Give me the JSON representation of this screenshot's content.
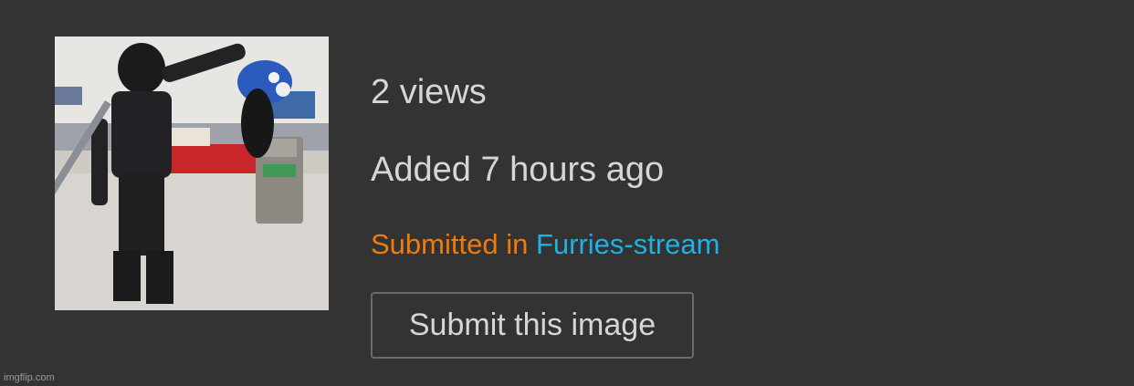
{
  "image": {
    "alt": "GIF thumbnail"
  },
  "stats": {
    "views": "2 views",
    "added": "Added 7 hours ago"
  },
  "submission": {
    "prefix": "Submitted in",
    "stream": "Furries-stream"
  },
  "actions": {
    "submit_label": "Submit this image"
  },
  "footer": {
    "watermark": "imgflip.com"
  },
  "colors": {
    "background": "#333333",
    "text": "#d6d6d6",
    "submitted_prefix": "#f07a0c",
    "stream_link": "#1fb0e6",
    "button_border": "#6a6a6a"
  }
}
